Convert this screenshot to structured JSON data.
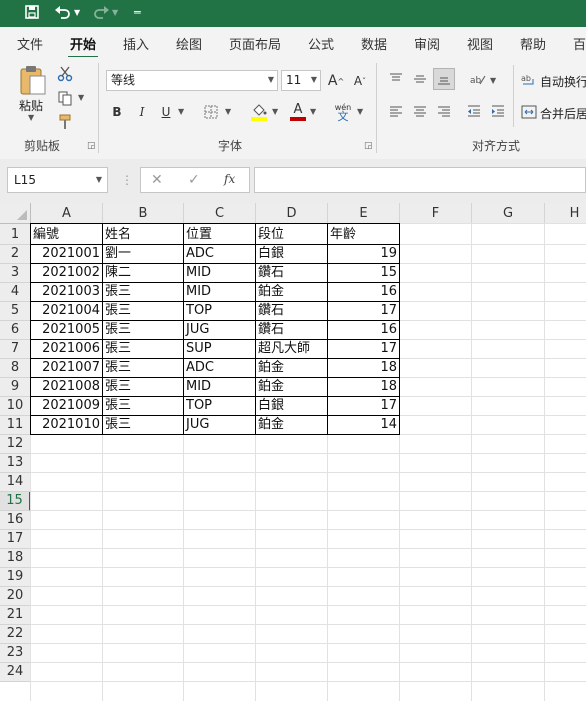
{
  "tabs": [
    "文件",
    "开始",
    "插入",
    "绘图",
    "页面布局",
    "公式",
    "数据",
    "审阅",
    "视图",
    "帮助",
    "百"
  ],
  "ribbon": {
    "clipboard": {
      "paste_label": "粘贴",
      "group_label": "剪贴板"
    },
    "font": {
      "font_name": "等线",
      "font_size": "11",
      "group_label": "字体",
      "bold": "B",
      "italic": "I",
      "underline": "U",
      "grow": "A",
      "shrink": "A",
      "font_color": "A",
      "phonetic": "wén"
    },
    "alignment": {
      "wrap_text": "自动换行",
      "merge_center": "合并后居",
      "group_label": "对齐方式"
    }
  },
  "formula_bar": {
    "name_box": "L15",
    "fx": "fx",
    "cancel": "✕",
    "confirm": "✓"
  },
  "colors": {
    "brand": "#217346",
    "underline_red": "#c00000",
    "highlight_yellow": "#ffff00"
  },
  "sheet": {
    "columns": [
      "A",
      "B",
      "C",
      "D",
      "E",
      "F",
      "G",
      "H"
    ],
    "row_numbers": [
      "1",
      "2",
      "3",
      "4",
      "5",
      "6",
      "7",
      "8",
      "9",
      "10",
      "11",
      "12",
      "13",
      "14",
      "15",
      "16",
      "17",
      "18",
      "19",
      "20",
      "21",
      "22",
      "23",
      "24"
    ],
    "selected_row": "15",
    "headers": [
      "編號",
      "姓名",
      "位置",
      "段位",
      "年齡"
    ],
    "rows": [
      [
        "2021001",
        "劉一",
        "ADC",
        "白銀",
        "19"
      ],
      [
        "2021002",
        "陳二",
        "MID",
        "鑽石",
        "15"
      ],
      [
        "2021003",
        "張三",
        "MID",
        "鉑金",
        "16"
      ],
      [
        "2021004",
        "張三",
        "TOP",
        "鑽石",
        "17"
      ],
      [
        "2021005",
        "張三",
        "JUG",
        "鑽石",
        "16"
      ],
      [
        "2021006",
        "張三",
        "SUP",
        "超凡大師",
        "17"
      ],
      [
        "2021007",
        "張三",
        "ADC",
        "鉑金",
        "18"
      ],
      [
        "2021008",
        "張三",
        "MID",
        "鉑金",
        "18"
      ],
      [
        "2021009",
        "張三",
        "TOP",
        "白銀",
        "17"
      ],
      [
        "2021010",
        "張三",
        "JUG",
        "鉑金",
        "14"
      ]
    ]
  }
}
